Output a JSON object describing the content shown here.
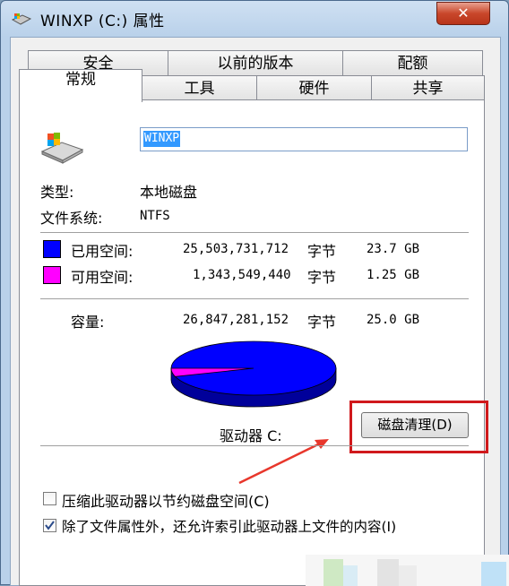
{
  "window": {
    "title": "WINXP (C:) 属性",
    "close_label": "✕"
  },
  "tabs_top": [
    "安全",
    "以前的版本",
    "配额"
  ],
  "tabs_bottom": [
    "常规",
    "工具",
    "硬件",
    "共享"
  ],
  "general": {
    "drive_name_value": "WINXP",
    "type_label": "类型:",
    "type_value": "本地磁盘",
    "fs_label": "文件系统:",
    "fs_value": "NTFS",
    "used": {
      "label": "已用空间:",
      "bytes": "25,503,731,712",
      "unit": "字节",
      "size": "23.7 GB",
      "color": "#0000ff"
    },
    "free": {
      "label": "可用空间:",
      "bytes": "1,343,549,440",
      "unit": "字节",
      "size": "1.25 GB",
      "color": "#ff00ff"
    },
    "capacity": {
      "label": "容量:",
      "bytes": "26,847,281,152",
      "unit": "字节",
      "size": "25.0 GB"
    },
    "drive_label": "驱动器 C:",
    "cleanup_button": "磁盘清理(D)",
    "compress_checkbox": {
      "label": "压缩此驱动器以节约磁盘空间(C)",
      "checked": false
    },
    "index_checkbox": {
      "label": "除了文件属性外，还允许索引此驱动器上文件的内容(I)",
      "checked": true
    },
    "used_fraction": 0.95
  },
  "colors": {
    "highlight": "#d0191c",
    "arrow": "#e8372c"
  }
}
